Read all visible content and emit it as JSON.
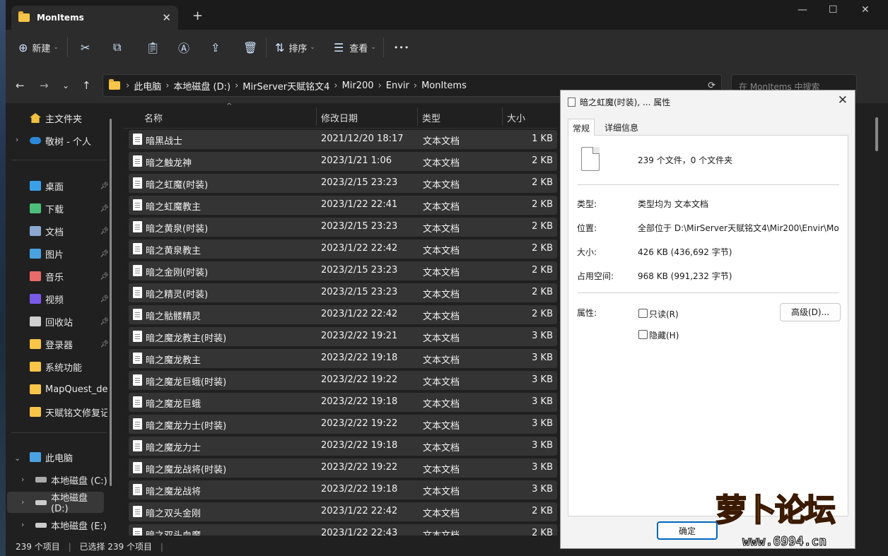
{
  "window": {
    "tab_title": "MonItems",
    "tab_close": "✕",
    "new_tab": "+",
    "min": "—",
    "max": "☐",
    "close": "✕"
  },
  "toolbar": {
    "new": "新建",
    "sort": "排序",
    "view": "查看",
    "more": "•••"
  },
  "address": {
    "crumbs": [
      "此电脑",
      "本地磁盘 (D:)",
      "MirServer天赋铭文4",
      "Mir200",
      "Envir",
      "MonItems"
    ],
    "search_placeholder": "在 MonItems 中搜索"
  },
  "sidebar": {
    "home": "主文件夹",
    "cloud": "敬树 - 个人",
    "quick": [
      {
        "label": "桌面",
        "pinned": true
      },
      {
        "label": "下载",
        "pinned": true
      },
      {
        "label": "文档",
        "pinned": true
      },
      {
        "label": "图片",
        "pinned": true
      },
      {
        "label": "音乐",
        "pinned": true
      },
      {
        "label": "视频",
        "pinned": true
      },
      {
        "label": "回收站",
        "pinned": true
      },
      {
        "label": "登录器",
        "pinned": true
      },
      {
        "label": "系统功能",
        "pinned": false
      },
      {
        "label": "MapQuest_def",
        "pinned": false
      },
      {
        "label": "天赋铭文修复记",
        "pinned": false
      }
    ],
    "this_pc": "此电脑",
    "drives": [
      "本地磁盘 (C:)",
      "本地磁盘 (D:)",
      "本地磁盘 (E:)"
    ]
  },
  "columns": {
    "name": "名称",
    "date": "修改日期",
    "type": "类型",
    "size": "大小"
  },
  "files": [
    {
      "name": "暗黑战士",
      "date": "2021/12/20 18:17",
      "type": "文本文档",
      "size": "1 KB"
    },
    {
      "name": "暗之触龙神",
      "date": "2023/1/21 1:06",
      "type": "文本文档",
      "size": "2 KB"
    },
    {
      "name": "暗之虹魔(时装)",
      "date": "2023/2/15 23:23",
      "type": "文本文档",
      "size": "2 KB"
    },
    {
      "name": "暗之虹魔教主",
      "date": "2023/1/22 22:41",
      "type": "文本文档",
      "size": "2 KB"
    },
    {
      "name": "暗之黄泉(时装)",
      "date": "2023/2/15 23:23",
      "type": "文本文档",
      "size": "2 KB"
    },
    {
      "name": "暗之黄泉教主",
      "date": "2023/1/22 22:42",
      "type": "文本文档",
      "size": "2 KB"
    },
    {
      "name": "暗之金刚(时装)",
      "date": "2023/2/15 23:23",
      "type": "文本文档",
      "size": "2 KB"
    },
    {
      "name": "暗之精灵(时装)",
      "date": "2023/2/15 23:23",
      "type": "文本文档",
      "size": "2 KB"
    },
    {
      "name": "暗之骷髅精灵",
      "date": "2023/1/22 22:42",
      "type": "文本文档",
      "size": "2 KB"
    },
    {
      "name": "暗之魔龙教主(时装)",
      "date": "2023/2/22 19:21",
      "type": "文本文档",
      "size": "3 KB"
    },
    {
      "name": "暗之魔龙教主",
      "date": "2023/2/22 19:18",
      "type": "文本文档",
      "size": "3 KB"
    },
    {
      "name": "暗之魔龙巨蛾(时装)",
      "date": "2023/2/22 19:22",
      "type": "文本文档",
      "size": "3 KB"
    },
    {
      "name": "暗之魔龙巨蛾",
      "date": "2023/2/22 19:18",
      "type": "文本文档",
      "size": "3 KB"
    },
    {
      "name": "暗之魔龙力士(时装)",
      "date": "2023/2/22 19:22",
      "type": "文本文档",
      "size": "3 KB"
    },
    {
      "name": "暗之魔龙力士",
      "date": "2023/2/22 19:18",
      "type": "文本文档",
      "size": "3 KB"
    },
    {
      "name": "暗之魔龙战将(时装)",
      "date": "2023/2/22 19:22",
      "type": "文本文档",
      "size": "3 KB"
    },
    {
      "name": "暗之魔龙战将",
      "date": "2023/2/22 19:18",
      "type": "文本文档",
      "size": "3 KB"
    },
    {
      "name": "暗之双头金刚",
      "date": "2023/1/22 22:42",
      "type": "文本文档",
      "size": "2 KB"
    },
    {
      "name": "暗之双头血魔",
      "date": "2023/1/22 22:43",
      "type": "文本文档",
      "size": "2 KB"
    }
  ],
  "status": {
    "count": "239 个项目",
    "selected": "已选择 239 个项目"
  },
  "dialog": {
    "title": "暗之虹魔(时装), ... 属性",
    "tabs": [
      "常规",
      "详细信息"
    ],
    "summary": "239 个文件，0 个文件夹",
    "type_label": "类型:",
    "type_value": "类型均为 文本文档",
    "loc_label": "位置:",
    "loc_value": "全部位于 D:\\MirServer天赋铭文4\\Mir200\\Envir\\Mo",
    "size_label": "大小:",
    "size_value": "426 KB (436,692 字节)",
    "disk_label": "占用空间:",
    "disk_value": "968 KB (991,232 字节)",
    "attr_label": "属性:",
    "readonly": "只读(R)",
    "hidden": "隐藏(H)",
    "advanced": "高级(D)...",
    "ok": "确定"
  },
  "watermark": {
    "logo": "萝卜论坛",
    "url": "www.6994.cn"
  }
}
